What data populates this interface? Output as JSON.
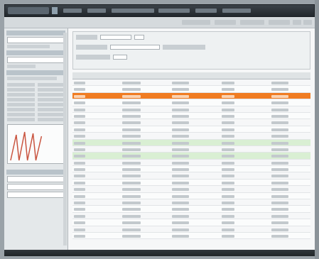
{
  "window": {
    "title": "",
    "menu": [
      "",
      "",
      "",
      "",
      "",
      ""
    ]
  },
  "subtoolbar": {
    "items": [
      "",
      "",
      "",
      "",
      "",
      ""
    ]
  },
  "sidebar": {
    "sections": [
      "",
      "",
      ""
    ],
    "search_value": "",
    "options": [
      "",
      "",
      "",
      "",
      "",
      "",
      "",
      "",
      "",
      "",
      "",
      "",
      "",
      ""
    ]
  },
  "filters": {
    "labels": [
      "",
      "",
      ""
    ],
    "values": [
      "",
      "",
      ""
    ]
  },
  "table": {
    "columns": [
      "",
      "",
      "",
      "",
      ""
    ],
    "rows": [
      {
        "c": [
          "",
          "",
          "",
          "",
          ""
        ]
      },
      {
        "c": [
          "",
          "",
          "",
          "",
          ""
        ]
      },
      {
        "c": [
          "",
          "",
          "",
          "",
          ""
        ],
        "state": "highlight"
      },
      {
        "c": [
          "",
          "",
          "",
          "",
          ""
        ]
      },
      {
        "c": [
          "",
          "",
          "",
          "",
          ""
        ]
      },
      {
        "c": [
          "",
          "",
          "",
          "",
          ""
        ]
      },
      {
        "c": [
          "",
          "",
          "",
          "",
          ""
        ]
      },
      {
        "c": [
          "",
          "",
          "",
          "",
          ""
        ]
      },
      {
        "c": [
          "",
          "",
          "",
          "",
          ""
        ]
      },
      {
        "c": [
          "",
          "",
          "",
          "",
          ""
        ],
        "state": "green"
      },
      {
        "c": [
          "",
          "",
          "",
          "",
          ""
        ]
      },
      {
        "c": [
          "",
          "",
          "",
          "",
          ""
        ],
        "state": "green"
      },
      {
        "c": [
          "",
          "",
          "",
          "",
          ""
        ]
      },
      {
        "c": [
          "",
          "",
          "",
          "",
          ""
        ]
      },
      {
        "c": [
          "",
          "",
          "",
          "",
          ""
        ]
      },
      {
        "c": [
          "",
          "",
          "",
          "",
          ""
        ]
      },
      {
        "c": [
          "",
          "",
          "",
          "",
          ""
        ]
      },
      {
        "c": [
          "",
          "",
          "",
          "",
          ""
        ]
      },
      {
        "c": [
          "",
          "",
          "",
          "",
          ""
        ]
      },
      {
        "c": [
          "",
          "",
          "",
          "",
          ""
        ]
      },
      {
        "c": [
          "",
          "",
          "",
          "",
          ""
        ]
      },
      {
        "c": [
          "",
          "",
          "",
          "",
          ""
        ]
      },
      {
        "c": [
          "",
          "",
          "",
          "",
          ""
        ]
      },
      {
        "c": [
          "",
          "",
          "",
          "",
          ""
        ]
      }
    ]
  },
  "colors": {
    "highlight": "#f07c22",
    "green_row": "#d9efd3",
    "toolbar": "#2b3136"
  },
  "icons": {
    "app": "app-icon",
    "table": "table-icon"
  }
}
